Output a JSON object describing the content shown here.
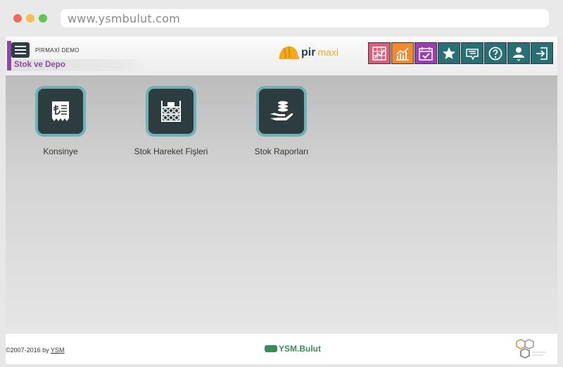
{
  "browser": {
    "url": "www.ysmbulut.com"
  },
  "header": {
    "company": "PİRMAXİ DEMO",
    "module": "Stok ve Depo",
    "logo": {
      "pir": "pir",
      "maxi": "maxi"
    },
    "toolbar": [
      {
        "name": "report-grid",
        "color": "#d95e7a"
      },
      {
        "name": "chart-up",
        "color": "#f08a2f"
      },
      {
        "name": "calendar-check",
        "color": "#9b3fb0"
      },
      {
        "name": "star",
        "color": "#2a6f76"
      },
      {
        "name": "message",
        "color": "#2a6f76"
      },
      {
        "name": "help",
        "color": "#2a6f76"
      },
      {
        "name": "user",
        "color": "#2a6f76"
      },
      {
        "name": "logout",
        "color": "#2a6f76"
      }
    ]
  },
  "tiles": [
    {
      "label": "Konsinye",
      "icon": "receipt-lira-icon"
    },
    {
      "label": "Stok Hareket Fişleri",
      "icon": "shelf-icon"
    },
    {
      "label": "Stok Raporları",
      "icon": "coins-hand-icon"
    }
  ],
  "footer": {
    "copyright": "©2007-2016 by ",
    "ysm": "YSM",
    "brand": "YSM.Bulut"
  }
}
